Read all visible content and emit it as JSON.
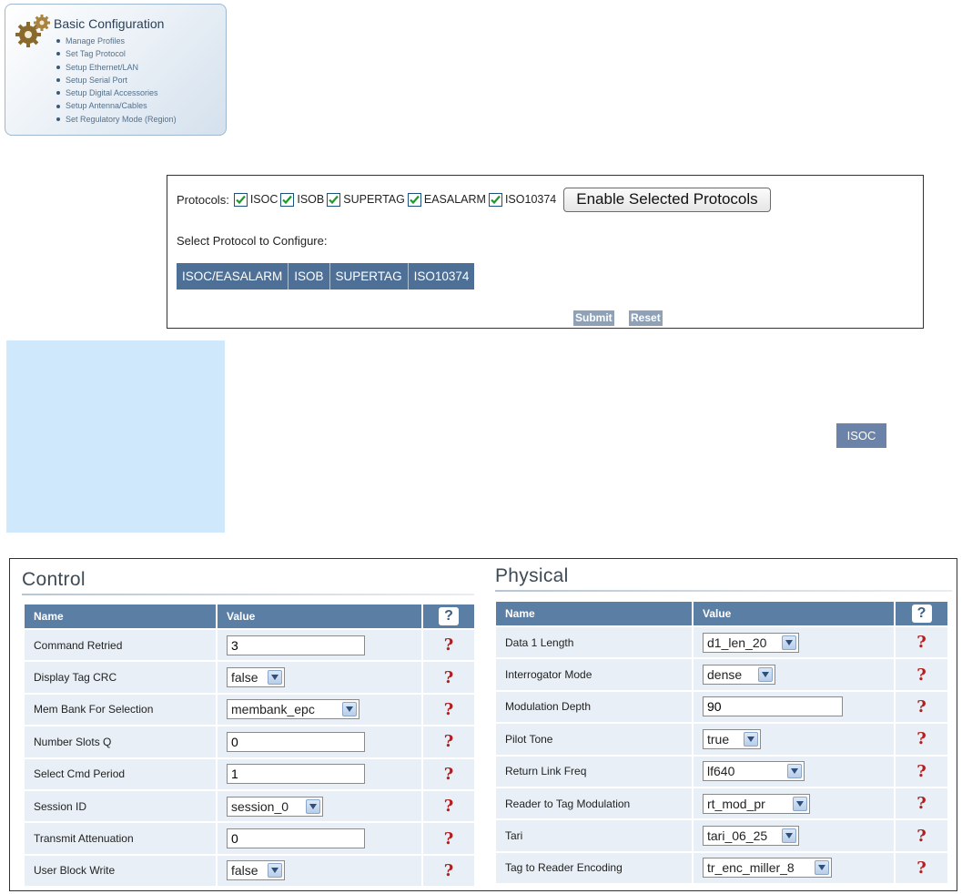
{
  "basic_config": {
    "title": "Basic Configuration",
    "items": [
      "Manage Profiles",
      "Set Tag Protocol",
      "Setup Ethernet/LAN",
      "Setup Serial Port",
      "Setup Digital Accessories",
      "Setup Antenna/Cables",
      "Set Regulatory Mode (Region)"
    ]
  },
  "protocols": {
    "label": "Protocols:",
    "items": [
      {
        "name": "ISOC",
        "checked": true
      },
      {
        "name": "ISOB",
        "checked": true
      },
      {
        "name": "SUPERTAG",
        "checked": true
      },
      {
        "name": "EASALARM",
        "checked": true
      },
      {
        "name": "ISO10374",
        "checked": true
      }
    ],
    "enable_button": "Enable Selected Protocols",
    "select_label": "Select Protocol to Configure:",
    "tabs": [
      "ISOC/EASALARM",
      "ISOB",
      "SUPERTAG",
      "ISO10374"
    ],
    "submit_label": "Submit",
    "reset_label": "Reset"
  },
  "isoc_chip": "ISOC",
  "control": {
    "title": "Control",
    "col_name": "Name",
    "col_value": "Value",
    "col_help": "?",
    "rows": [
      {
        "name": "Command Retried",
        "type": "input",
        "value": "3"
      },
      {
        "name": "Display Tag CRC",
        "type": "select",
        "value": "false"
      },
      {
        "name": "Mem Bank For Selection",
        "type": "select",
        "value": "membank_epc"
      },
      {
        "name": "Number Slots Q",
        "type": "input",
        "value": "0"
      },
      {
        "name": "Select Cmd Period",
        "type": "input",
        "value": "1"
      },
      {
        "name": "Session ID",
        "type": "select",
        "value": "session_0"
      },
      {
        "name": "Transmit Attenuation",
        "type": "input",
        "value": "0"
      },
      {
        "name": "User Block Write",
        "type": "select",
        "value": "false"
      }
    ],
    "help_mark": "?"
  },
  "physical": {
    "title": "Physical",
    "col_name": "Name",
    "col_value": "Value",
    "col_help": "?",
    "rows": [
      {
        "name": "Data 1 Length",
        "type": "select",
        "value": "d1_len_20"
      },
      {
        "name": "Interrogator Mode",
        "type": "select",
        "value": "dense"
      },
      {
        "name": "Modulation Depth",
        "type": "input",
        "value": "90"
      },
      {
        "name": "Pilot Tone",
        "type": "select",
        "value": "true"
      },
      {
        "name": "Return Link Freq",
        "type": "select",
        "value": "lf640"
      },
      {
        "name": "Reader to Tag Modulation",
        "type": "select",
        "value": "rt_mod_pr"
      },
      {
        "name": "Tari",
        "type": "select",
        "value": "tari_06_25"
      },
      {
        "name": "Tag to Reader Encoding",
        "type": "select",
        "value": "tr_enc_miller_8"
      }
    ],
    "help_mark": "?"
  },
  "colors": {
    "header_blue": "#5b7ea5",
    "row_bg": "#e8eff6",
    "tab_blue": "#4e6f96",
    "help_red": "#b02020",
    "side_panel": "#cfe8fb"
  }
}
